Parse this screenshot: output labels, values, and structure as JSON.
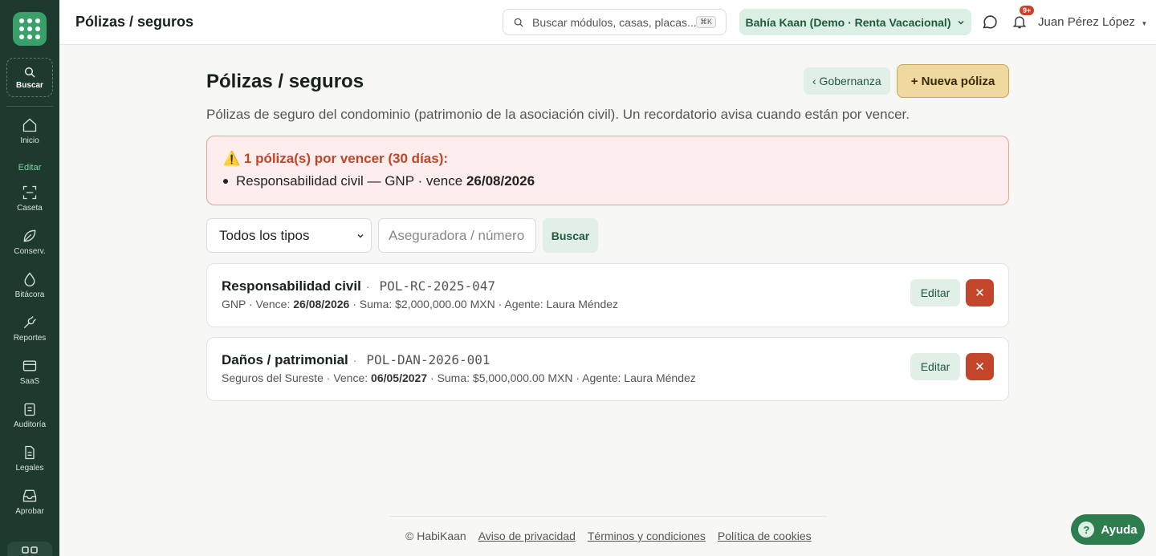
{
  "sidebar": {
    "search_label": "Buscar",
    "items": [
      {
        "label": "Inicio",
        "icon": "home-icon"
      },
      {
        "label": "Caseta",
        "icon": "scan-icon"
      },
      {
        "label": "Conserv.",
        "icon": "leaf-icon"
      },
      {
        "label": "Bitácora",
        "icon": "drop-icon"
      },
      {
        "label": "Reportes",
        "icon": "wrench-icon"
      },
      {
        "label": "SaaS",
        "icon": "card-icon"
      },
      {
        "label": "Auditoría",
        "icon": "clipboard-icon"
      },
      {
        "label": "Legales",
        "icon": "document-icon"
      },
      {
        "label": "Aprobar",
        "icon": "inbox-icon"
      }
    ],
    "section_label": "Editar"
  },
  "topbar": {
    "title": "Pólizas / seguros",
    "search_placeholder": "Buscar módulos, casas, placas...",
    "search_shortcut": "⌘K",
    "org": "Bahía Kaan (Demo · Renta Vacacional)",
    "notifications_badge": "9+",
    "user": "Juan Pérez López"
  },
  "page": {
    "title": "Pólizas / seguros",
    "back_label": "‹ Gobernanza",
    "new_label": "+ Nueva póliza",
    "subtitle": "Pólizas de seguro del condominio (patrimonio de la asociación civil). Un recordatorio avisa cuando están por vencer."
  },
  "alert": {
    "title": "⚠️ 1 póliza(s) por vencer (30 días):",
    "item_text": "Responsabilidad civil — GNP · vence ",
    "item_date": "26/08/2026"
  },
  "filters": {
    "type_value": "Todos los tipos",
    "search_placeholder": "Aseguradora / número",
    "search_button": "Buscar"
  },
  "policies": [
    {
      "type": "Responsabilidad civil",
      "number": "POL-RC-2025-047",
      "insurer": "GNP",
      "expires_label": "Vence:",
      "expires": "26/08/2026",
      "amount": "Suma: $2,000,000.00 MXN",
      "agent": "Agente: Laura Méndez",
      "edit_label": "Editar"
    },
    {
      "type": "Daños / patrimonial",
      "number": "POL-DAN-2026-001",
      "insurer": "Seguros del Sureste",
      "expires_label": "Vence:",
      "expires": "06/05/2027",
      "amount": "Suma: $5,000,000.00 MXN",
      "agent": "Agente: Laura Méndez",
      "edit_label": "Editar"
    }
  ],
  "footer": {
    "copyright": "© HabiKaan",
    "privacy": "Aviso de privacidad",
    "terms": "Términos y condiciones",
    "cookies": "Política de cookies"
  },
  "help_label": "Ayuda",
  "colors": {
    "sidebar_bg": "#1e3a2f",
    "accent_green": "#3aa06a",
    "alert_red": "#c0442a",
    "delete_red": "#c3462c",
    "new_button": "#efd9a1"
  }
}
